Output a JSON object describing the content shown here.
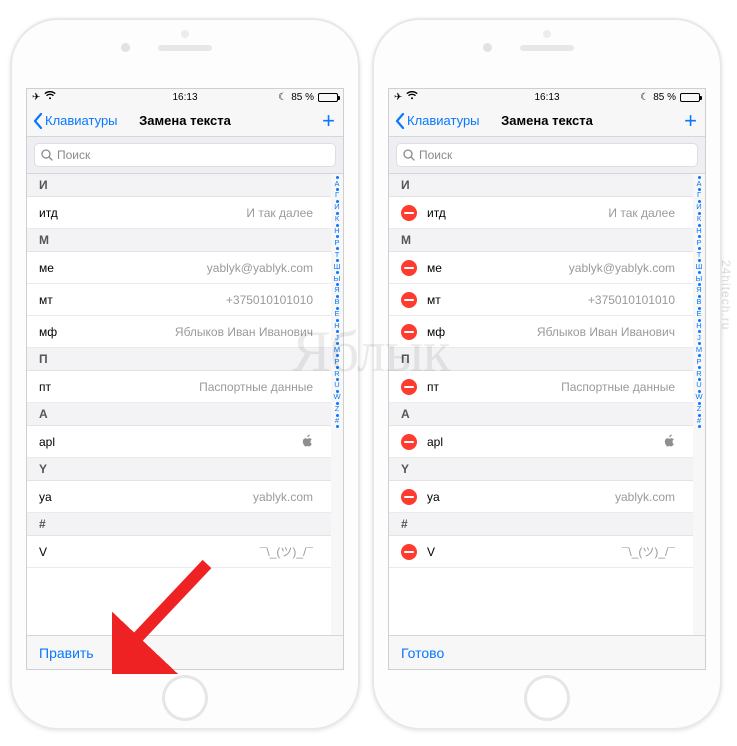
{
  "status": {
    "time": "16:13",
    "battery_pct": "85 %"
  },
  "nav": {
    "back": "Клавиатуры",
    "title": "Замена текста"
  },
  "search": {
    "placeholder": "Поиск"
  },
  "index_letters": [
    "А",
    "Г",
    "И",
    "К",
    "Н",
    "Р",
    "Т",
    "Ш",
    "Ы",
    "Я",
    "B",
    "E",
    "H",
    "J",
    "M",
    "P",
    "R",
    "U",
    "W",
    "Z",
    "#"
  ],
  "sections": [
    {
      "letter": "И",
      "rows": [
        {
          "shortcut": "итд",
          "phrase": "И так далее"
        }
      ]
    },
    {
      "letter": "М",
      "rows": [
        {
          "shortcut": "ме",
          "phrase": "yablyk@yablyk.com"
        },
        {
          "shortcut": "мт",
          "phrase": "+375010101010"
        },
        {
          "shortcut": "мф",
          "phrase": "Яблыков Иван Иванович"
        }
      ]
    },
    {
      "letter": "П",
      "rows": [
        {
          "shortcut": "пт",
          "phrase": "Паспортные данные"
        }
      ]
    },
    {
      "letter": "A",
      "rows": [
        {
          "shortcut": "apl",
          "phrase": "__APPLE__"
        }
      ]
    },
    {
      "letter": "Y",
      "rows": [
        {
          "shortcut": "ya",
          "phrase": "yablyk.com"
        }
      ]
    },
    {
      "letter": "#",
      "rows": [
        {
          "shortcut": "V",
          "phrase": "¯\\_(ツ)_/¯"
        }
      ]
    }
  ],
  "toolbar": {
    "left_edit": "Править",
    "right_done": "Готово"
  },
  "watermark": {
    "logo": "Яблык",
    "site": "24hitech.ru"
  }
}
